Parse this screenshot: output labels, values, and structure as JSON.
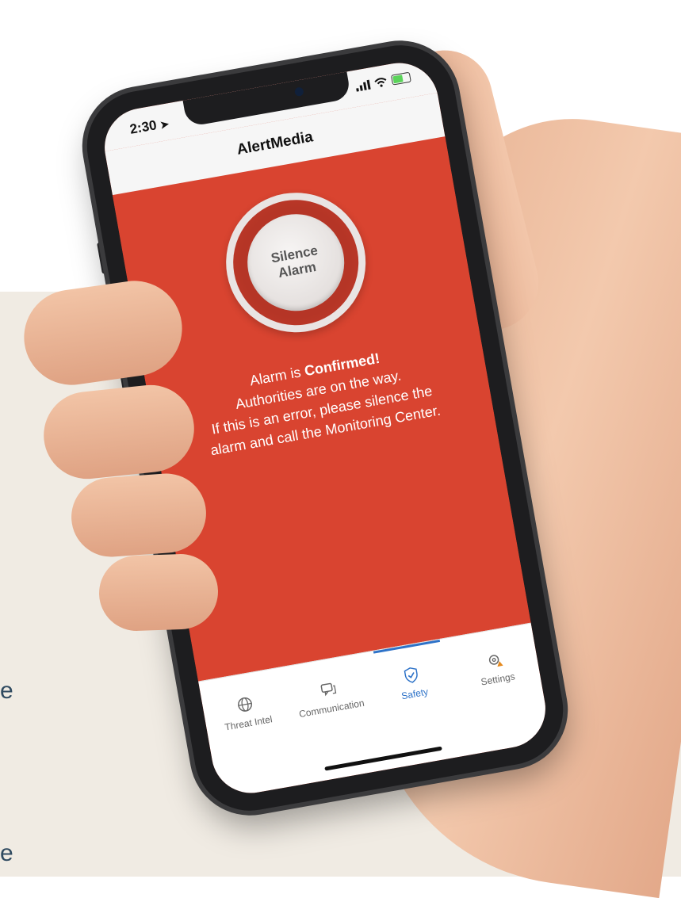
{
  "background": {
    "beige_color": "#f0ebe3",
    "edge_letters": [
      "e",
      "e"
    ]
  },
  "status_bar": {
    "time": "2:30",
    "location_icon": "location-arrow-icon",
    "signal_icon": "signal-icon",
    "wifi_icon": "wifi-icon",
    "battery_icon": "battery-charging-icon"
  },
  "nav": {
    "title": "AlertMedia"
  },
  "alarm": {
    "button_label": "Silence\nAlarm",
    "message_prefix": "Alarm is ",
    "message_status": "Confirmed!",
    "message_line2": "Authorities are on the way.",
    "message_line3": "If this is an error, please silence the",
    "message_line4": "alarm and call the Monitoring Center.",
    "background_color": "#d94430"
  },
  "tabs": {
    "active_color": "#2d72c8",
    "items": [
      {
        "label": "Threat Intel",
        "icon": "globe-icon"
      },
      {
        "label": "Communication",
        "icon": "chat-icon"
      },
      {
        "label": "Safety",
        "icon": "shield-check-icon"
      },
      {
        "label": "Settings",
        "icon": "gear-warning-icon"
      }
    ]
  }
}
